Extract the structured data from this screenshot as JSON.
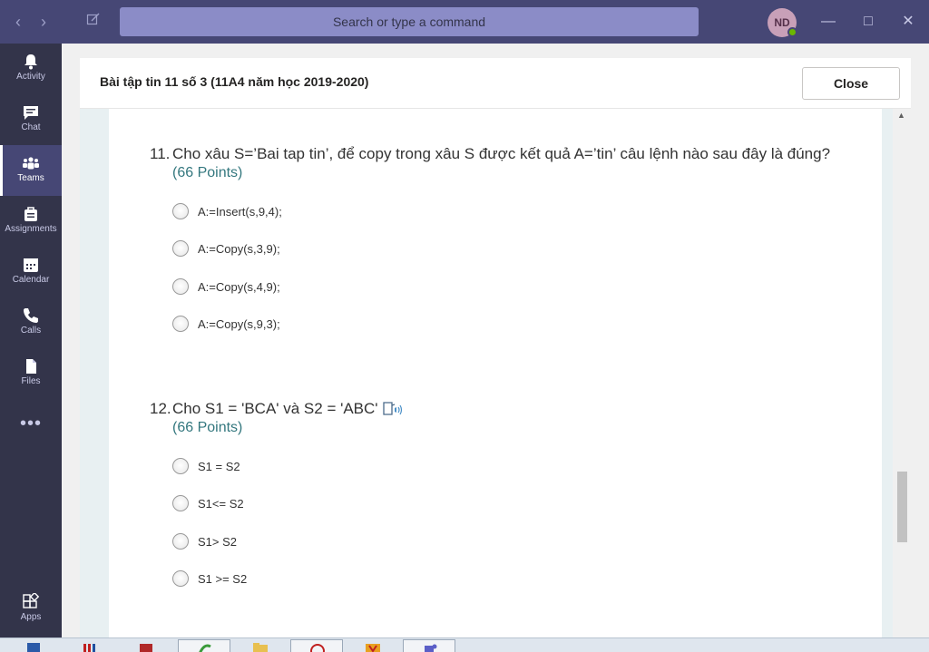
{
  "titlebar": {
    "search_placeholder": "Search or type a command",
    "avatar_initials": "ND"
  },
  "rail": {
    "items": [
      {
        "label": "Activity",
        "icon": "bell-icon"
      },
      {
        "label": "Chat",
        "icon": "chat-icon"
      },
      {
        "label": "Teams",
        "icon": "teams-icon",
        "active": true
      },
      {
        "label": "Assignments",
        "icon": "assignments-icon"
      },
      {
        "label": "Calendar",
        "icon": "calendar-icon"
      },
      {
        "label": "Calls",
        "icon": "phone-icon"
      },
      {
        "label": "Files",
        "icon": "file-icon"
      }
    ],
    "more_label": "•••",
    "apps_label": "Apps"
  },
  "dialog": {
    "title": "Bài tập tin 11 số 3 (11A4 năm học 2019-2020)",
    "close_label": "Close"
  },
  "questions": [
    {
      "number": "11.",
      "text": "Cho xâu S=’Bai tap tin’, để copy trong xâu S được kết quả A=’tin’ câu lệnh nào sau đây là đúng?",
      "points": "(66 Points)",
      "options": [
        "A:=Insert(s,9,4);",
        "A:=Copy(s,3,9);",
        "A:=Copy(s,4,9);",
        "A:=Copy(s,9,3);"
      ]
    },
    {
      "number": "12.",
      "text": "Cho S1 = 'BCA' và S2 =  'ABC'",
      "points": "(66 Points)",
      "options": [
        "S1 = S2",
        "S1<= S2",
        "S1> S2",
        "S1 >= S2"
      ]
    }
  ],
  "colors": {
    "titlebar": "#464775",
    "rail": "#33344a",
    "points": "#33777e"
  }
}
